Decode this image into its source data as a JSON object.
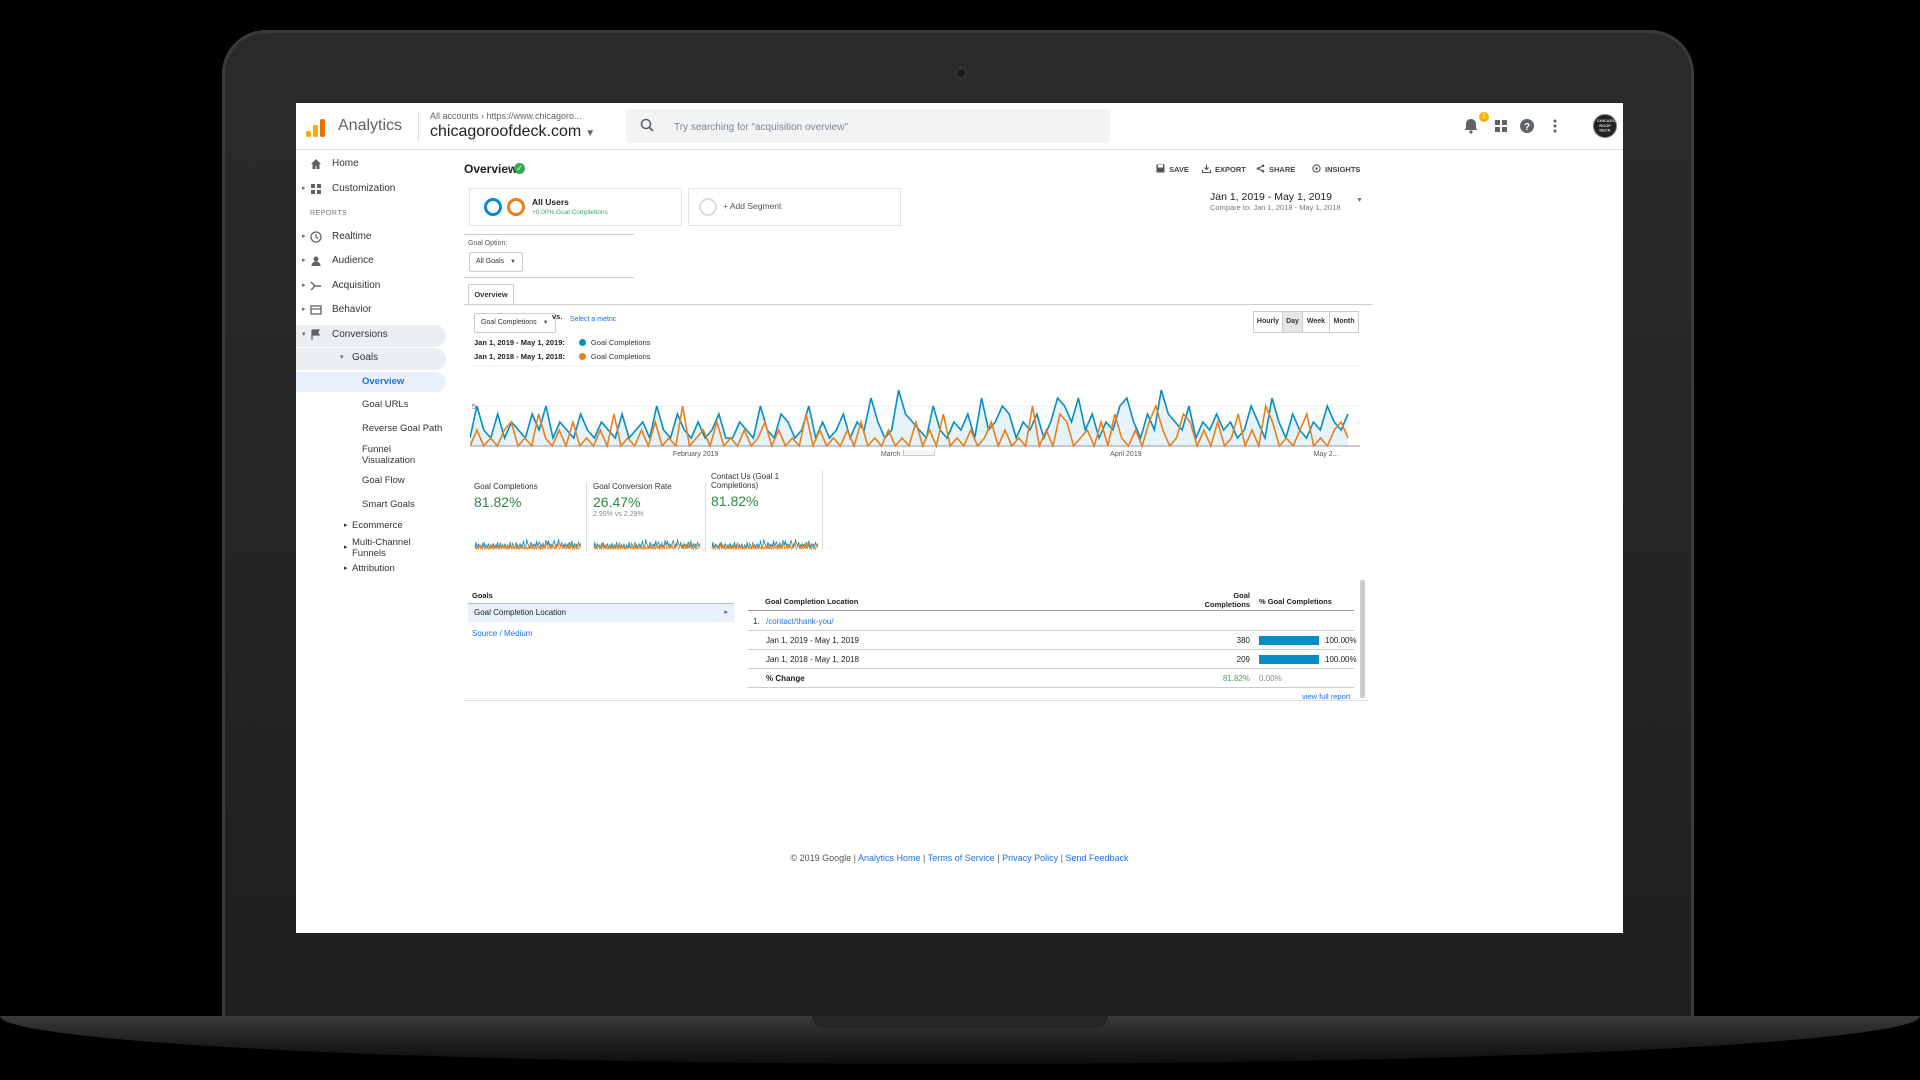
{
  "app": {
    "brand": "Analytics",
    "breadcrumb": "All accounts › https://www.chicagoro...",
    "property": "chicagoroofdeck.com",
    "search_placeholder": "Try searching for \"acquisition overview\"",
    "notification_count": "1",
    "avatar_text": "CHICAGO ROOF DECK"
  },
  "sidebar": {
    "home": "Home",
    "customization": "Customization",
    "reports_label": "REPORTS",
    "realtime": "Realtime",
    "audience": "Audience",
    "acquisition": "Acquisition",
    "behavior": "Behavior",
    "conversions": "Conversions",
    "goals": "Goals",
    "goals_items": [
      "Overview",
      "Goal URLs",
      "Reverse Goal Path",
      "Funnel Visualization",
      "Goal Flow",
      "Smart Goals"
    ],
    "ecommerce": "Ecommerce",
    "multi_channel": "Multi-Channel Funnels",
    "attribution": "Attribution"
  },
  "header": {
    "title": "Overview",
    "save": "SAVE",
    "export": "EXPORT",
    "share": "SHARE",
    "insights": "INSIGHTS"
  },
  "segments": {
    "all_users": "All Users",
    "all_users_sub": "+0.00% Goal Completions",
    "add_segment": "+ Add Segment"
  },
  "date": {
    "range": "Jan 1, 2019 - May 1, 2019",
    "compare": "Compare to: Jan 1, 2018 - May 1, 2018"
  },
  "goal_option": {
    "label": "Goal Option:",
    "value": "All Goals"
  },
  "tabs": {
    "overview": "Overview"
  },
  "metric_controls": {
    "metric": "Goal Completions",
    "vs": "vs.",
    "select_metric": "Select a metric",
    "granularity": [
      "Hourly",
      "Day",
      "Week",
      "Month"
    ],
    "active_granularity": "Day"
  },
  "legend": [
    {
      "range": "Jan 1, 2019 - May 1, 2019:",
      "metric": "Goal Completions",
      "color": "#058dc7"
    },
    {
      "range": "Jan 1, 2018 - May 1, 2018:",
      "metric": "Goal Completions",
      "color": "#ed7e17"
    }
  ],
  "chart_data": {
    "type": "line",
    "x_tick_labels": [
      "February 2019",
      "March 2019",
      "April 2019",
      "May 2..."
    ],
    "y_tick_labels": [
      "5"
    ],
    "ylim": [
      0,
      10
    ],
    "series": [
      {
        "name": "Jan 1, 2019 - May 1, 2019",
        "color": "#058dc7",
        "values": [
          1,
          5,
          2,
          1,
          4,
          1,
          3,
          2,
          1,
          4,
          2,
          5,
          1,
          3,
          2,
          1,
          4,
          2,
          1,
          3,
          2,
          1,
          4,
          1,
          2,
          3,
          1,
          5,
          2,
          1,
          4,
          2,
          1,
          3,
          1,
          2,
          4,
          1,
          1,
          3,
          2,
          1,
          5,
          2,
          1,
          4,
          3,
          1,
          2,
          5,
          1,
          3,
          1,
          2,
          4,
          1,
          3,
          2,
          6,
          3,
          1,
          2,
          7,
          4,
          3,
          2,
          1,
          5,
          2,
          1,
          3,
          2,
          4,
          1,
          6,
          2,
          3,
          5,
          4,
          1,
          3,
          2,
          4,
          1,
          3,
          6,
          5,
          3,
          6,
          2,
          4,
          1,
          3,
          2,
          5,
          6,
          3,
          1,
          4,
          2,
          7,
          4,
          3,
          2,
          5,
          1,
          3,
          2,
          4,
          2,
          3,
          1,
          2,
          5,
          3,
          1,
          6,
          3,
          1,
          4,
          2,
          1,
          3,
          2,
          5,
          3,
          2,
          4
        ]
      },
      {
        "name": "Jan 1, 2018 - May 1, 2018",
        "color": "#ed7e17",
        "values": [
          0,
          2,
          0,
          1,
          0,
          2,
          3,
          0,
          1,
          0,
          4,
          1,
          0,
          2,
          0,
          3,
          0,
          1,
          0,
          2,
          0,
          4,
          0,
          1,
          0,
          2,
          0,
          3,
          0,
          1,
          0,
          5,
          0,
          1,
          2,
          0,
          3,
          0,
          1,
          0,
          2,
          0,
          1,
          3,
          0,
          2,
          0,
          1,
          0,
          4,
          0,
          2,
          0,
          1,
          0,
          2,
          0,
          3,
          0,
          1,
          0,
          2,
          0,
          1,
          0,
          3,
          0,
          2,
          0,
          4,
          0,
          1,
          0,
          2,
          0,
          1,
          3,
          0,
          2,
          0,
          1,
          0,
          5,
          0,
          2,
          0,
          4,
          3,
          0,
          1,
          2,
          0,
          3,
          0,
          4,
          1,
          0,
          2,
          0,
          3,
          5,
          2,
          0,
          1,
          4,
          3,
          0,
          2,
          0,
          3,
          0,
          1,
          4,
          0,
          2,
          0,
          5,
          3,
          0,
          1,
          0,
          2,
          4,
          0,
          1,
          0,
          2,
          3,
          1
        ]
      }
    ]
  },
  "scorecards": [
    {
      "label": "Goal Completions",
      "value": "81.82%",
      "sub": ""
    },
    {
      "label": "Goal Conversion Rate",
      "value": "26.47%",
      "sub": "2.90% vs 2.29%"
    },
    {
      "label": "Contact Us (Goal 1 Completions)",
      "value": "81.82%",
      "sub": ""
    }
  ],
  "goals_panel": {
    "heading": "Goals",
    "selected": "Goal Completion Location",
    "link": "Source / Medium"
  },
  "table": {
    "col1": "Goal Completion Location",
    "col2": "Goal Completions",
    "col3": "% Goal Completions",
    "row_index": "1.",
    "row_path": "/contact/thank-you/",
    "rows": [
      {
        "label": "Jan 1, 2019 - May 1, 2019",
        "value": "380",
        "pct": "100.00%",
        "fill": 1.0
      },
      {
        "label": "Jan 1, 2018 - May 1, 2018",
        "value": "209",
        "pct": "100.00%",
        "fill": 1.0
      }
    ],
    "change_label": "% Change",
    "change_value": "81.82%",
    "change_pct": "0.00%",
    "view_full": "view full report"
  },
  "footer": {
    "copyright": "© 2019 Google | ",
    "links": [
      "Analytics Home",
      "Terms of Service",
      "Privacy Policy",
      "Send Feedback"
    ],
    "sep": " | "
  }
}
